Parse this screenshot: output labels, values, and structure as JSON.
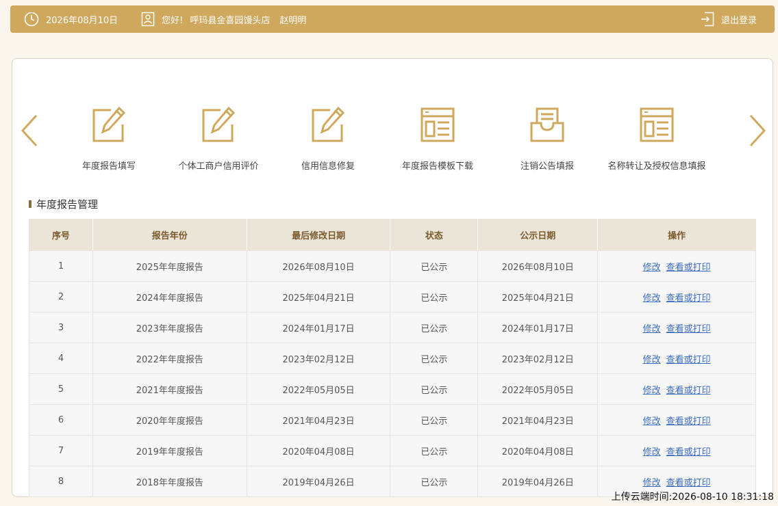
{
  "header": {
    "date": "2026年08月10日",
    "greeting": "您好!",
    "shop_name": "呼玛县金喜园馒头店",
    "user_name": "赵明明",
    "logout_label": "退出登录"
  },
  "menu": [
    {
      "label": "年度报告填写",
      "icon": "edit-icon"
    },
    {
      "label": "个体工商户信用评价",
      "icon": "edit-icon"
    },
    {
      "label": "信用信息修复",
      "icon": "edit-icon"
    },
    {
      "label": "年度报告模板下载",
      "icon": "template-icon"
    },
    {
      "label": "注销公告填报",
      "icon": "inbox-icon"
    },
    {
      "label": "名称转让及授权信息填报",
      "icon": "template-icon"
    }
  ],
  "section": {
    "title": "年度报告管理"
  },
  "table": {
    "headers": [
      "序号",
      "报告年份",
      "最后修改日期",
      "状态",
      "公示日期",
      "操作"
    ],
    "action_edit": "修改",
    "action_view": "查看或打印",
    "rows": [
      [
        "1",
        "2025年年度报告",
        "2026年08月10日",
        "已公示",
        "2026年08月10日"
      ],
      [
        "2",
        "2024年年度报告",
        "2025年04月21日",
        "已公示",
        "2025年04月21日"
      ],
      [
        "3",
        "2023年年度报告",
        "2024年01月17日",
        "已公示",
        "2024年01月17日"
      ],
      [
        "4",
        "2022年年度报告",
        "2023年02月12日",
        "已公示",
        "2023年02月12日"
      ],
      [
        "5",
        "2021年年度报告",
        "2022年05月05日",
        "已公示",
        "2022年05月05日"
      ],
      [
        "6",
        "2020年年度报告",
        "2021年04月23日",
        "已公示",
        "2021年04月23日"
      ],
      [
        "7",
        "2019年年度报告",
        "2020年04月08日",
        "已公示",
        "2020年04月08日"
      ],
      [
        "8",
        "2018年年度报告",
        "2019年04月26日",
        "已公示",
        "2019年04月26日"
      ]
    ]
  },
  "footer": {
    "upload_time": "上传云端时间:2026-08-10 18:31:18"
  },
  "colors": {
    "accent": "#cfa85e",
    "link": "#3a6bc0",
    "header_bg": "#ebe4d9"
  }
}
